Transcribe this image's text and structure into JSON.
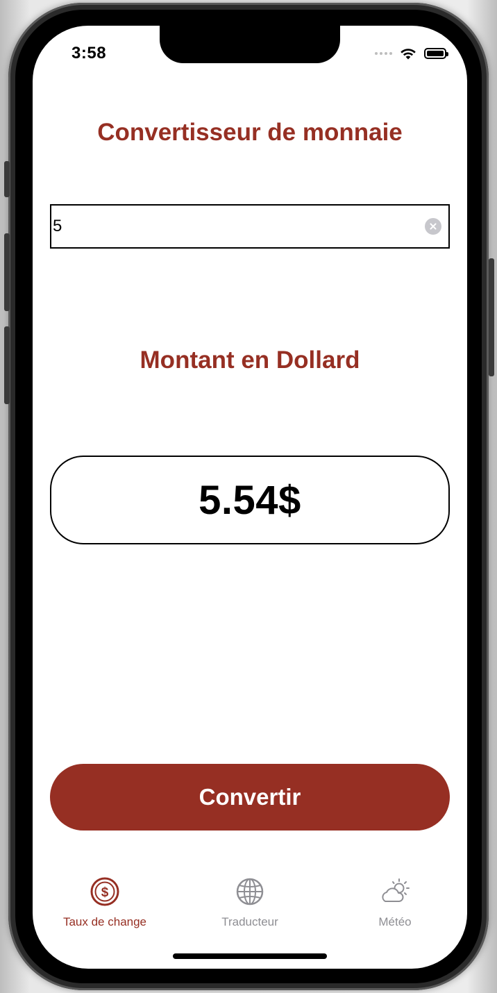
{
  "status_bar": {
    "time": "3:58",
    "icons": [
      "signal-dots-icon",
      "wifi-icon",
      "battery-icon"
    ]
  },
  "main": {
    "title": "Convertisseur de monnaie",
    "amount_input": {
      "value": "5",
      "placeholder": ""
    },
    "result_label": "Montant en Dollard",
    "result_value": "5.54$",
    "convert_label": "Convertir"
  },
  "tabbar": {
    "tabs": [
      {
        "label": "Taux de change",
        "icon": "dollar-circle-icon",
        "active": true
      },
      {
        "label": "Traducteur",
        "icon": "globe-icon",
        "active": false
      },
      {
        "label": "Météo",
        "icon": "cloud-sun-icon",
        "active": false
      }
    ]
  },
  "colors": {
    "accent": "#962f23",
    "inactive": "#8e8e93",
    "background": "#ffffff"
  }
}
